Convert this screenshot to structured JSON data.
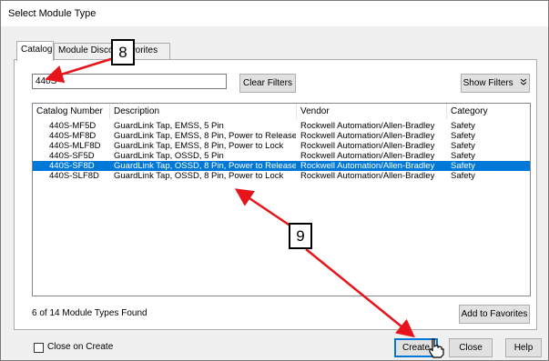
{
  "window": {
    "title": "Select Module Type"
  },
  "tabs": [
    {
      "label": "Catalog"
    },
    {
      "label": "Module Discovery"
    },
    {
      "label": "Favorites"
    }
  ],
  "search": {
    "value": "440S"
  },
  "toolbar": {
    "clear_filters_label": "Clear Filters",
    "show_filters_label": "Show Filters",
    "show_filters_icon": "chevrons-down"
  },
  "table": {
    "columns": [
      "Catalog Number",
      "Description",
      "Vendor",
      "Category"
    ],
    "rows": [
      {
        "catalog": "440S-MF5D",
        "description": "GuardLink Tap, EMSS, 5 Pin",
        "vendor": "Rockwell Automation/Allen-Bradley",
        "category": "Safety",
        "selected": false
      },
      {
        "catalog": "440S-MF8D",
        "description": "GuardLink Tap, EMSS, 8 Pin, Power to Release",
        "vendor": "Rockwell Automation/Allen-Bradley",
        "category": "Safety",
        "selected": false
      },
      {
        "catalog": "440S-MLF8D",
        "description": "GuardLink Tap, EMSS, 8 Pin, Power to Lock",
        "vendor": "Rockwell Automation/Allen-Bradley",
        "category": "Safety",
        "selected": false
      },
      {
        "catalog": "440S-SF5D",
        "description": "GuardLink Tap, OSSD, 5 Pin",
        "vendor": "Rockwell Automation/Allen-Bradley",
        "category": "Safety",
        "selected": false
      },
      {
        "catalog": "440S-SF8D",
        "description": "GuardLink Tap, OSSD, 8 Pin, Power to Release",
        "vendor": "Rockwell Automation/Allen-Bradley",
        "category": "Safety",
        "selected": true
      },
      {
        "catalog": "440S-SLF8D",
        "description": "GuardLink Tap, OSSD, 8 Pin, Power to Lock",
        "vendor": "Rockwell Automation/Allen-Bradley",
        "category": "Safety",
        "selected": false
      }
    ]
  },
  "status": {
    "found_text": "6 of 14 Module Types Found"
  },
  "buttons": {
    "add_favorites": "Add to Favorites",
    "create": "Create",
    "close": "Close",
    "help": "Help"
  },
  "close_on_create": {
    "label": "Close on Create",
    "checked": false
  },
  "annotations": {
    "callout_8": "8",
    "callout_9": "9",
    "arrow_color": "#e8141b"
  },
  "colors": {
    "selection": "#0078d7",
    "accent_border": "#0078d7"
  }
}
